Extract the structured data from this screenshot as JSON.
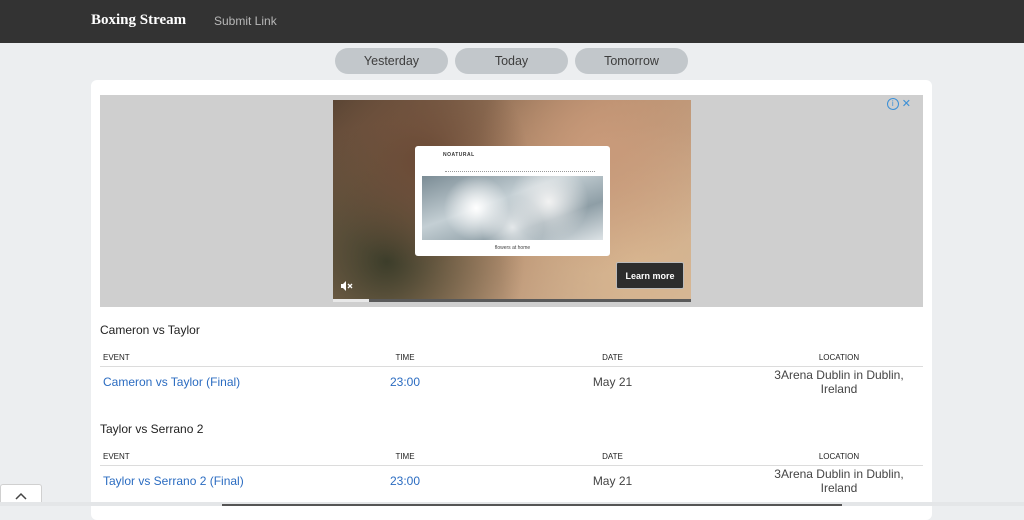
{
  "navbar": {
    "brand": "Boxing Stream",
    "submit_link": "Submit Link"
  },
  "day_tabs": [
    {
      "label": "Yesterday"
    },
    {
      "label": "Today"
    },
    {
      "label": "Tomorrow"
    }
  ],
  "ad": {
    "popup_brand": "NOATURAL",
    "popup_caption": "flowers at home",
    "learn_more": "Learn more",
    "progress": 0.1
  },
  "events": [
    {
      "title": "Cameron vs Taylor",
      "columns": [
        "EVENT",
        "TIME",
        "DATE",
        "LOCATION"
      ],
      "rows": [
        {
          "event": "Cameron vs Taylor (Final)",
          "time": "23:00",
          "date": "May 21",
          "location": "3Arena Dublin in Dublin, Ireland"
        }
      ]
    },
    {
      "title": "Taylor vs Serrano 2",
      "columns": [
        "EVENT",
        "TIME",
        "DATE",
        "LOCATION"
      ],
      "rows": [
        {
          "event": "Taylor vs Serrano 2 (Final)",
          "time": "23:00",
          "date": "May 21",
          "location": "3Arena Dublin in Dublin, Ireland"
        }
      ]
    }
  ],
  "colors": {
    "navbar": "#333333",
    "link": "#2b6cc1",
    "tab": "#c2c7cb"
  }
}
